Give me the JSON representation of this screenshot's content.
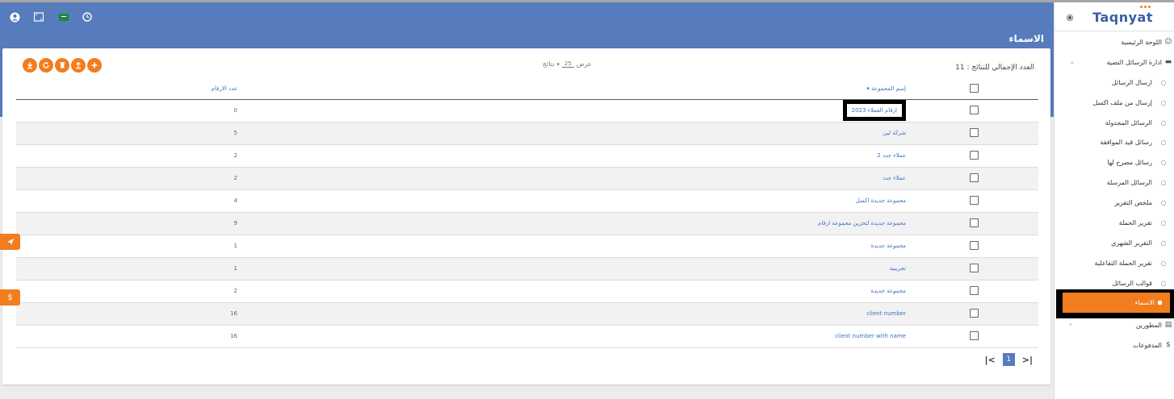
{
  "colors": {
    "brand_blue": "#567cbd",
    "accent_orange": "#f27d1f",
    "link_blue": "#3c70c3",
    "highlight_border": "#000000"
  },
  "header": {
    "page_title": "الاسماء",
    "icons": [
      "user-circle-icon",
      "fullscreen-icon",
      "flag-icon",
      "clock-icon"
    ]
  },
  "toolbar": {
    "icons": [
      "add-icon",
      "upload-icon",
      "delete-icon",
      "refresh-icon",
      "download-icon"
    ]
  },
  "display": {
    "label_show": "عرض",
    "per_page": "25",
    "label_results": "نتائج"
  },
  "total_label": "العدد الإجمالي للنتائج : 11",
  "table": {
    "headers": {
      "name": "إسم المجموعة ▾",
      "count": "عدد الارقام"
    },
    "rows": [
      {
        "name": "ارقام العملاء 2023",
        "count": "0"
      },
      {
        "name": "شركة لين",
        "count": "5"
      },
      {
        "name": "عملاء جدد 2",
        "count": "2"
      },
      {
        "name": "عملاء جدد",
        "count": "2"
      },
      {
        "name": "مجموعة جديدة اكسل",
        "count": "4"
      },
      {
        "name": "مجموعة جديدة لتخزين مجموعة ارقام",
        "count": "9"
      },
      {
        "name": "مجموعة جديدة",
        "count": "1"
      },
      {
        "name": "تجريبية",
        "count": "1"
      },
      {
        "name": "مجموعة جديدة",
        "count": "2"
      },
      {
        "name": "client number",
        "count": "16"
      },
      {
        "name": "client number with name",
        "count": "16"
      }
    ]
  },
  "pagination": {
    "first": "|<",
    "current": "1",
    "last": ">|"
  },
  "float_tabs": {
    "send_icon": "send-icon",
    "billing": "$"
  },
  "sidebar": {
    "logo": "Taqnyat",
    "items": [
      {
        "label": "اللوحة الرئيسية",
        "icon": "☺"
      },
      {
        "label": "ادارة الرسائل النصية",
        "icon": "▬",
        "chev": "⌄"
      },
      {
        "label": "ارسال الرسائل",
        "icon": "○"
      },
      {
        "label": "إرسال من ملف اكسل",
        "icon": "○"
      },
      {
        "label": "الرسائل المجدولة",
        "icon": "○"
      },
      {
        "label": "رسائل قيد الموافقة",
        "icon": "○"
      },
      {
        "label": "رسائل مصرح لها",
        "icon": "○"
      },
      {
        "label": "الرسائل المرسلة",
        "icon": "○"
      },
      {
        "label": "ملخص التقرير",
        "icon": "○"
      },
      {
        "label": "تقرير الحملة",
        "icon": "○"
      },
      {
        "label": "التقرير الشهري",
        "icon": "○"
      },
      {
        "label": "تقرير الحملة التفاعلية",
        "icon": "○"
      },
      {
        "label": "قوالب الرسائل",
        "icon": "○"
      },
      {
        "label": "المطورين",
        "icon": "▤",
        "chev": "‹"
      },
      {
        "label": "المدفوعات",
        "icon": "$"
      }
    ],
    "active_item": "الاسماء"
  }
}
